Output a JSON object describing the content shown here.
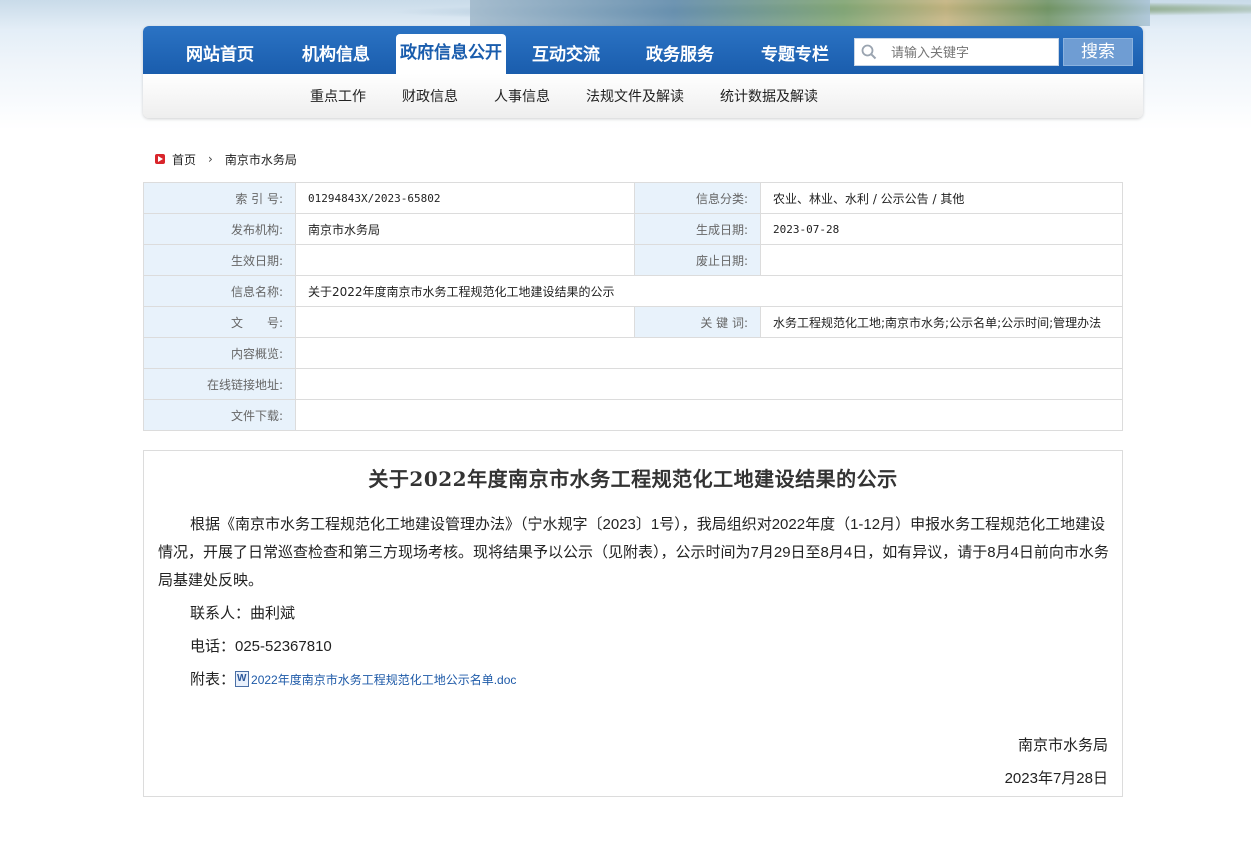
{
  "nav": {
    "items": [
      "网站首页",
      "机构信息",
      "政府信息公开",
      "互动交流",
      "政务服务",
      "专题专栏"
    ],
    "active_index": 2,
    "search_placeholder": "请输入关键字",
    "search_button": "搜索",
    "sub_items": [
      "重点工作",
      "财政信息",
      "人事信息",
      "法规文件及解读",
      "统计数据及解读"
    ]
  },
  "breadcrumb": {
    "home": "首页",
    "current": "南京市水务局"
  },
  "meta": {
    "index_label": "索 引 号:",
    "index_value": "01294843X/2023-65802",
    "category_label": "信息分类:",
    "category_value": "农业、林业、水利 / 公示公告 / 其他",
    "publisher_label": "发布机构:",
    "publisher_value": "南京市水务局",
    "created_label": "生成日期:",
    "created_value": "2023-07-28",
    "effective_label": "生效日期:",
    "effective_value": "",
    "abolish_label": "废止日期:",
    "abolish_value": "",
    "name_label": "信息名称:",
    "name_value": "关于2022年度南京市水务工程规范化工地建设结果的公示",
    "docno_label": "文　　号:",
    "docno_value": "",
    "keywords_label": "关 键 词:",
    "keywords_value": "水务工程规范化工地;南京市水务;公示名单;公示时间;管理办法",
    "summary_label": "内容概览:",
    "summary_value": "",
    "link_label": "在线链接地址:",
    "link_value": "",
    "download_label": "文件下载:",
    "download_value": ""
  },
  "article": {
    "title": "关于2022年度南京市水务工程规范化工地建设结果的公示",
    "paragraph": "根据《南京市水务工程规范化工地建设管理办法》（宁水规字〔2023〕1号），我局组织对2022年度（1-12月）申报水务工程规范化工地建设情况，开展了日常巡查检查和第三方现场考核。现将结果予以公示（见附表），公示时间为7月29日至8月4日，如有异议，请于8月4日前向市水务局基建处反映。",
    "contact": "联系人：曲利斌",
    "phone": "电话：025-52367810",
    "attachment_label": "附表：",
    "attachment_link": "2022年度南京市水务工程规范化工地公示名单.doc",
    "signature": "南京市水务局",
    "date": "2023年7月28日"
  },
  "colors": {
    "nav_blue": "#1a5dad",
    "label_bg": "#e8f2fb",
    "link": "#1e5aa8"
  }
}
